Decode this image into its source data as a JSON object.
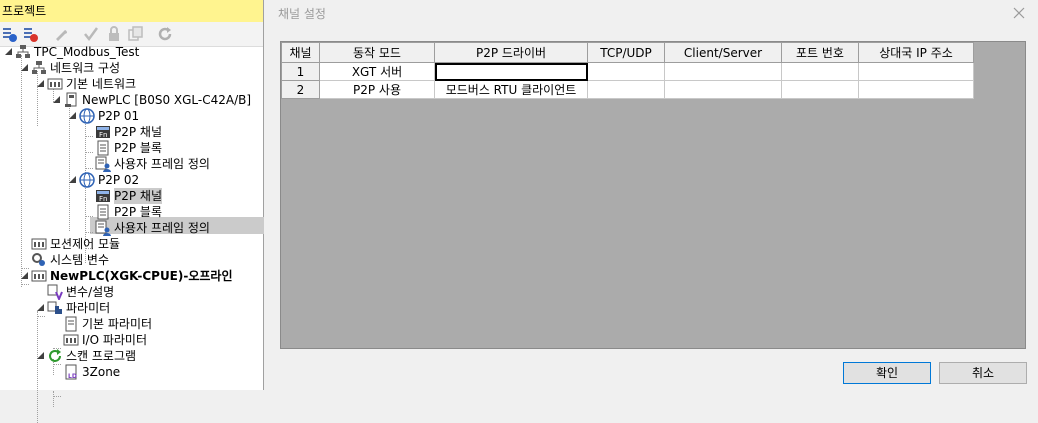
{
  "project_panel": {
    "title": "프로젝트",
    "tree": [
      {
        "label": "TPC_Modbus_Test",
        "icon": "project-icon"
      },
      {
        "label": "네트워크 구성",
        "icon": "network-config-icon"
      },
      {
        "label": "기본 네트워크",
        "icon": "basic-network-icon"
      },
      {
        "label": "NewPLC [B0S0 XGL-C42A/B]",
        "icon": "module-icon"
      },
      {
        "label": "P2P 01",
        "icon": "p2p-icon"
      },
      {
        "label": "P2P 채널",
        "icon": "p2p-channel-icon"
      },
      {
        "label": "P2P 블록",
        "icon": "p2p-block-icon"
      },
      {
        "label": "사용자 프레임 정의",
        "icon": "user-frame-icon"
      },
      {
        "label": "P2P 02",
        "icon": "p2p-icon"
      },
      {
        "label": "P2P 채널",
        "icon": "p2p-channel-icon"
      },
      {
        "label": "P2P 블록",
        "icon": "p2p-block-icon"
      },
      {
        "label": "사용자 프레임 정의",
        "icon": "user-frame-icon"
      },
      {
        "label": "모션제어 모듈",
        "icon": "motion-module-icon"
      },
      {
        "label": "시스템 변수",
        "icon": "system-variable-icon"
      },
      {
        "label": "NewPLC(XGK-CPUE)-오프라인",
        "icon": "plc-icon"
      },
      {
        "label": "변수/설명",
        "icon": "variable-icon"
      },
      {
        "label": "파라미터",
        "icon": "parameter-icon"
      },
      {
        "label": "기본 파라미터",
        "icon": "basic-parameter-icon"
      },
      {
        "label": "I/O 파라미터",
        "icon": "io-parameter-icon"
      },
      {
        "label": "스캔 프로그램",
        "icon": "scan-program-icon"
      },
      {
        "label": "3Zone",
        "icon": "ladder-program-icon"
      }
    ]
  },
  "dialog": {
    "title": "채널 설정",
    "columns": [
      "채널",
      "동작 모드",
      "P2P 드라이버",
      "TCP/UDP",
      "Client/Server",
      "포트 번호",
      "상대국 IP 주소"
    ],
    "rows": [
      [
        "1",
        "XGT 서버",
        "",
        "",
        "",
        "",
        ""
      ],
      [
        "2",
        "P2P 사용",
        "모드버스 RTU 클라이언트",
        "",
        "",
        "",
        ""
      ]
    ],
    "ok_label": "확인",
    "cancel_label": "취소"
  }
}
